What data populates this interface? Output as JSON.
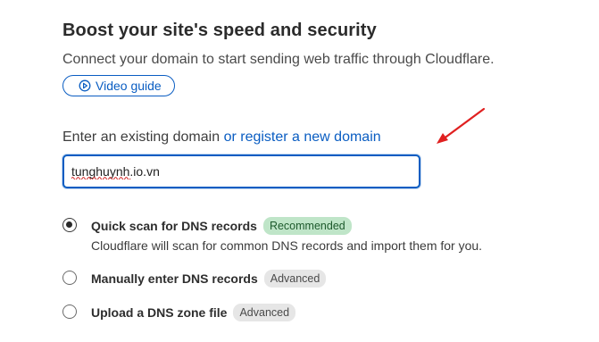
{
  "header": {
    "title": "Boost your site's speed and security",
    "subtitle": "Connect your domain to start sending web traffic through Cloudflare."
  },
  "video_guide": {
    "label": "Video guide",
    "icon": "play-circle-icon"
  },
  "domain": {
    "prompt_text": "Enter an existing domain",
    "register_link": "or register a new domain",
    "input_value": "tunghuynh.io.vn"
  },
  "options": [
    {
      "label": "Quick scan for DNS records",
      "badge": "Recommended",
      "description": "Cloudflare will scan for common DNS records and import them for you.",
      "selected": true
    },
    {
      "label": "Manually enter DNS records",
      "badge": "Advanced",
      "selected": false
    },
    {
      "label": "Upload a DNS zone file",
      "badge": "Advanced",
      "selected": false
    }
  ],
  "colors": {
    "accent": "#0a5dc2",
    "annotation_arrow": "#e02020",
    "recommended_badge": "#bfe5c8",
    "advanced_badge": "#e6e6e6"
  }
}
